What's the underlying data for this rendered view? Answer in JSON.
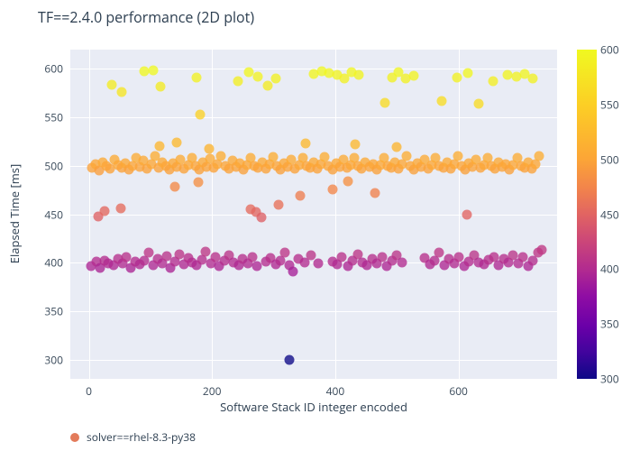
{
  "chart_data": {
    "type": "scatter",
    "title": "TF==2.4.0 performance (2D plot)",
    "xlabel": "Software Stack ID integer encoded",
    "ylabel": "Elapsed Time [ms]",
    "xlim": [
      -30,
      760
    ],
    "ylim": [
      280,
      620
    ],
    "x_ticks": [
      0,
      200,
      400,
      600
    ],
    "y_ticks": [
      300,
      350,
      400,
      450,
      500,
      550,
      600
    ],
    "colorbar": {
      "ticks": [
        300,
        350,
        400,
        450,
        500,
        550,
        600
      ],
      "min": 300,
      "max": 600
    },
    "legend": [
      {
        "label": "solver==rhel-8.3-py38",
        "color": "#e37b5b"
      }
    ],
    "series": [
      {
        "name": "solver==rhel-8.3-py38",
        "color_by": "elapsed_time",
        "points": [
          {
            "x": 326,
            "y": 300
          },
          {
            "x": 3,
            "y": 396
          },
          {
            "x": 12,
            "y": 401
          },
          {
            "x": 18,
            "y": 395
          },
          {
            "x": 25,
            "y": 402
          },
          {
            "x": 31,
            "y": 399
          },
          {
            "x": 40,
            "y": 397
          },
          {
            "x": 48,
            "y": 404
          },
          {
            "x": 55,
            "y": 399
          },
          {
            "x": 61,
            "y": 406
          },
          {
            "x": 68,
            "y": 395
          },
          {
            "x": 75,
            "y": 401
          },
          {
            "x": 82,
            "y": 398
          },
          {
            "x": 90,
            "y": 402
          },
          {
            "x": 98,
            "y": 410
          },
          {
            "x": 105,
            "y": 397
          },
          {
            "x": 112,
            "y": 404
          },
          {
            "x": 119,
            "y": 399
          },
          {
            "x": 126,
            "y": 407
          },
          {
            "x": 132,
            "y": 395
          },
          {
            "x": 140,
            "y": 401
          },
          {
            "x": 147,
            "y": 409
          },
          {
            "x": 154,
            "y": 398
          },
          {
            "x": 161,
            "y": 405
          },
          {
            "x": 168,
            "y": 400
          },
          {
            "x": 175,
            "y": 397
          },
          {
            "x": 183,
            "y": 403
          },
          {
            "x": 190,
            "y": 411
          },
          {
            "x": 198,
            "y": 399
          },
          {
            "x": 205,
            "y": 406
          },
          {
            "x": 212,
            "y": 396
          },
          {
            "x": 220,
            "y": 402
          },
          {
            "x": 228,
            "y": 408
          },
          {
            "x": 235,
            "y": 400
          },
          {
            "x": 243,
            "y": 397
          },
          {
            "x": 250,
            "y": 404
          },
          {
            "x": 258,
            "y": 399
          },
          {
            "x": 265,
            "y": 406
          },
          {
            "x": 273,
            "y": 396
          },
          {
            "x": 288,
            "y": 401
          },
          {
            "x": 295,
            "y": 405
          },
          {
            "x": 303,
            "y": 398
          },
          {
            "x": 311,
            "y": 402
          },
          {
            "x": 318,
            "y": 410
          },
          {
            "x": 325,
            "y": 397
          },
          {
            "x": 332,
            "y": 391
          },
          {
            "x": 340,
            "y": 404
          },
          {
            "x": 350,
            "y": 400
          },
          {
            "x": 360,
            "y": 408
          },
          {
            "x": 372,
            "y": 399
          },
          {
            "x": 395,
            "y": 401
          },
          {
            "x": 403,
            "y": 398
          },
          {
            "x": 411,
            "y": 406
          },
          {
            "x": 420,
            "y": 396
          },
          {
            "x": 428,
            "y": 402
          },
          {
            "x": 436,
            "y": 409
          },
          {
            "x": 444,
            "y": 400
          },
          {
            "x": 452,
            "y": 397
          },
          {
            "x": 460,
            "y": 404
          },
          {
            "x": 468,
            "y": 399
          },
          {
            "x": 476,
            "y": 406
          },
          {
            "x": 484,
            "y": 396
          },
          {
            "x": 492,
            "y": 402
          },
          {
            "x": 500,
            "y": 408
          },
          {
            "x": 508,
            "y": 400
          },
          {
            "x": 545,
            "y": 405
          },
          {
            "x": 553,
            "y": 398
          },
          {
            "x": 561,
            "y": 402
          },
          {
            "x": 569,
            "y": 410
          },
          {
            "x": 577,
            "y": 397
          },
          {
            "x": 585,
            "y": 404
          },
          {
            "x": 593,
            "y": 399
          },
          {
            "x": 601,
            "y": 406
          },
          {
            "x": 609,
            "y": 396
          },
          {
            "x": 617,
            "y": 401
          },
          {
            "x": 625,
            "y": 408
          },
          {
            "x": 633,
            "y": 400
          },
          {
            "x": 641,
            "y": 398
          },
          {
            "x": 649,
            "y": 403
          },
          {
            "x": 657,
            "y": 406
          },
          {
            "x": 665,
            "y": 397
          },
          {
            "x": 673,
            "y": 404
          },
          {
            "x": 681,
            "y": 400
          },
          {
            "x": 689,
            "y": 408
          },
          {
            "x": 697,
            "y": 399
          },
          {
            "x": 705,
            "y": 406
          },
          {
            "x": 713,
            "y": 396
          },
          {
            "x": 721,
            "y": 402
          },
          {
            "x": 729,
            "y": 410
          },
          {
            "x": 735,
            "y": 413
          },
          {
            "x": 5,
            "y": 498
          },
          {
            "x": 11,
            "y": 502
          },
          {
            "x": 17,
            "y": 495
          },
          {
            "x": 23,
            "y": 504
          },
          {
            "x": 29,
            "y": 500
          },
          {
            "x": 35,
            "y": 497
          },
          {
            "x": 41,
            "y": 506
          },
          {
            "x": 47,
            "y": 501
          },
          {
            "x": 53,
            "y": 498
          },
          {
            "x": 59,
            "y": 503
          },
          {
            "x": 65,
            "y": 496
          },
          {
            "x": 71,
            "y": 500
          },
          {
            "x": 77,
            "y": 508
          },
          {
            "x": 83,
            "y": 499
          },
          {
            "x": 89,
            "y": 505
          },
          {
            "x": 95,
            "y": 497
          },
          {
            "x": 101,
            "y": 502
          },
          {
            "x": 107,
            "y": 510
          },
          {
            "x": 113,
            "y": 498
          },
          {
            "x": 119,
            "y": 504
          },
          {
            "x": 125,
            "y": 500
          },
          {
            "x": 131,
            "y": 496
          },
          {
            "x": 137,
            "y": 503
          },
          {
            "x": 143,
            "y": 499
          },
          {
            "x": 149,
            "y": 506
          },
          {
            "x": 155,
            "y": 497
          },
          {
            "x": 161,
            "y": 501
          },
          {
            "x": 167,
            "y": 508
          },
          {
            "x": 173,
            "y": 500
          },
          {
            "x": 179,
            "y": 496
          },
          {
            "x": 185,
            "y": 504
          },
          {
            "x": 191,
            "y": 499
          },
          {
            "x": 197,
            "y": 507
          },
          {
            "x": 203,
            "y": 498
          },
          {
            "x": 209,
            "y": 502
          },
          {
            "x": 215,
            "y": 510
          },
          {
            "x": 221,
            "y": 500
          },
          {
            "x": 227,
            "y": 497
          },
          {
            "x": 233,
            "y": 505
          },
          {
            "x": 239,
            "y": 499
          },
          {
            "x": 245,
            "y": 503
          },
          {
            "x": 251,
            "y": 496
          },
          {
            "x": 257,
            "y": 501
          },
          {
            "x": 263,
            "y": 508
          },
          {
            "x": 269,
            "y": 500
          },
          {
            "x": 275,
            "y": 498
          },
          {
            "x": 281,
            "y": 504
          },
          {
            "x": 287,
            "y": 497
          },
          {
            "x": 293,
            "y": 502
          },
          {
            "x": 299,
            "y": 509
          },
          {
            "x": 305,
            "y": 500
          },
          {
            "x": 311,
            "y": 496
          },
          {
            "x": 317,
            "y": 503
          },
          {
            "x": 323,
            "y": 499
          },
          {
            "x": 329,
            "y": 506
          },
          {
            "x": 335,
            "y": 497
          },
          {
            "x": 341,
            "y": 501
          },
          {
            "x": 347,
            "y": 508
          },
          {
            "x": 353,
            "y": 500
          },
          {
            "x": 359,
            "y": 498
          },
          {
            "x": 365,
            "y": 504
          },
          {
            "x": 371,
            "y": 497
          },
          {
            "x": 377,
            "y": 502
          },
          {
            "x": 383,
            "y": 509
          },
          {
            "x": 389,
            "y": 500
          },
          {
            "x": 395,
            "y": 496
          },
          {
            "x": 401,
            "y": 503
          },
          {
            "x": 407,
            "y": 499
          },
          {
            "x": 413,
            "y": 506
          },
          {
            "x": 419,
            "y": 498
          },
          {
            "x": 425,
            "y": 501
          },
          {
            "x": 431,
            "y": 508
          },
          {
            "x": 437,
            "y": 500
          },
          {
            "x": 443,
            "y": 497
          },
          {
            "x": 449,
            "y": 504
          },
          {
            "x": 455,
            "y": 499
          },
          {
            "x": 461,
            "y": 502
          },
          {
            "x": 467,
            "y": 496
          },
          {
            "x": 473,
            "y": 501
          },
          {
            "x": 479,
            "y": 508
          },
          {
            "x": 485,
            "y": 500
          },
          {
            "x": 491,
            "y": 498
          },
          {
            "x": 497,
            "y": 504
          },
          {
            "x": 503,
            "y": 497
          },
          {
            "x": 509,
            "y": 502
          },
          {
            "x": 515,
            "y": 510
          },
          {
            "x": 521,
            "y": 500
          },
          {
            "x": 527,
            "y": 496
          },
          {
            "x": 533,
            "y": 503
          },
          {
            "x": 539,
            "y": 499
          },
          {
            "x": 545,
            "y": 506
          },
          {
            "x": 551,
            "y": 497
          },
          {
            "x": 557,
            "y": 501
          },
          {
            "x": 563,
            "y": 508
          },
          {
            "x": 569,
            "y": 500
          },
          {
            "x": 575,
            "y": 498
          },
          {
            "x": 581,
            "y": 504
          },
          {
            "x": 587,
            "y": 497
          },
          {
            "x": 593,
            "y": 502
          },
          {
            "x": 599,
            "y": 510
          },
          {
            "x": 605,
            "y": 500
          },
          {
            "x": 611,
            "y": 496
          },
          {
            "x": 617,
            "y": 503
          },
          {
            "x": 623,
            "y": 499
          },
          {
            "x": 629,
            "y": 506
          },
          {
            "x": 635,
            "y": 498
          },
          {
            "x": 641,
            "y": 501
          },
          {
            "x": 647,
            "y": 508
          },
          {
            "x": 653,
            "y": 500
          },
          {
            "x": 659,
            "y": 497
          },
          {
            "x": 665,
            "y": 504
          },
          {
            "x": 671,
            "y": 499
          },
          {
            "x": 677,
            "y": 502
          },
          {
            "x": 683,
            "y": 496
          },
          {
            "x": 689,
            "y": 501
          },
          {
            "x": 695,
            "y": 508
          },
          {
            "x": 701,
            "y": 500
          },
          {
            "x": 707,
            "y": 498
          },
          {
            "x": 713,
            "y": 504
          },
          {
            "x": 719,
            "y": 497
          },
          {
            "x": 725,
            "y": 502
          },
          {
            "x": 731,
            "y": 510
          },
          {
            "x": 15,
            "y": 448
          },
          {
            "x": 25,
            "y": 453
          },
          {
            "x": 52,
            "y": 456
          },
          {
            "x": 140,
            "y": 478
          },
          {
            "x": 178,
            "y": 483
          },
          {
            "x": 262,
            "y": 455
          },
          {
            "x": 272,
            "y": 452
          },
          {
            "x": 280,
            "y": 447
          },
          {
            "x": 308,
            "y": 460
          },
          {
            "x": 343,
            "y": 469
          },
          {
            "x": 395,
            "y": 476
          },
          {
            "x": 420,
            "y": 484
          },
          {
            "x": 465,
            "y": 472
          },
          {
            "x": 614,
            "y": 450
          },
          {
            "x": 115,
            "y": 520
          },
          {
            "x": 142,
            "y": 524
          },
          {
            "x": 195,
            "y": 518
          },
          {
            "x": 352,
            "y": 523
          },
          {
            "x": 433,
            "y": 522
          },
          {
            "x": 500,
            "y": 519
          },
          {
            "x": 38,
            "y": 584
          },
          {
            "x": 54,
            "y": 576
          },
          {
            "x": 90,
            "y": 598
          },
          {
            "x": 105,
            "y": 599
          },
          {
            "x": 116,
            "y": 582
          },
          {
            "x": 175,
            "y": 591
          },
          {
            "x": 180,
            "y": 553
          },
          {
            "x": 242,
            "y": 587
          },
          {
            "x": 260,
            "y": 597
          },
          {
            "x": 275,
            "y": 592
          },
          {
            "x": 290,
            "y": 583
          },
          {
            "x": 303,
            "y": 590
          },
          {
            "x": 365,
            "y": 595
          },
          {
            "x": 378,
            "y": 598
          },
          {
            "x": 390,
            "y": 596
          },
          {
            "x": 403,
            "y": 594
          },
          {
            "x": 415,
            "y": 590
          },
          {
            "x": 427,
            "y": 597
          },
          {
            "x": 438,
            "y": 594
          },
          {
            "x": 480,
            "y": 565
          },
          {
            "x": 492,
            "y": 591
          },
          {
            "x": 503,
            "y": 597
          },
          {
            "x": 514,
            "y": 590
          },
          {
            "x": 528,
            "y": 593
          },
          {
            "x": 573,
            "y": 567
          },
          {
            "x": 598,
            "y": 591
          },
          {
            "x": 615,
            "y": 596
          },
          {
            "x": 632,
            "y": 564
          },
          {
            "x": 656,
            "y": 587
          },
          {
            "x": 680,
            "y": 594
          },
          {
            "x": 694,
            "y": 592
          },
          {
            "x": 707,
            "y": 595
          },
          {
            "x": 721,
            "y": 590
          }
        ]
      }
    ]
  }
}
